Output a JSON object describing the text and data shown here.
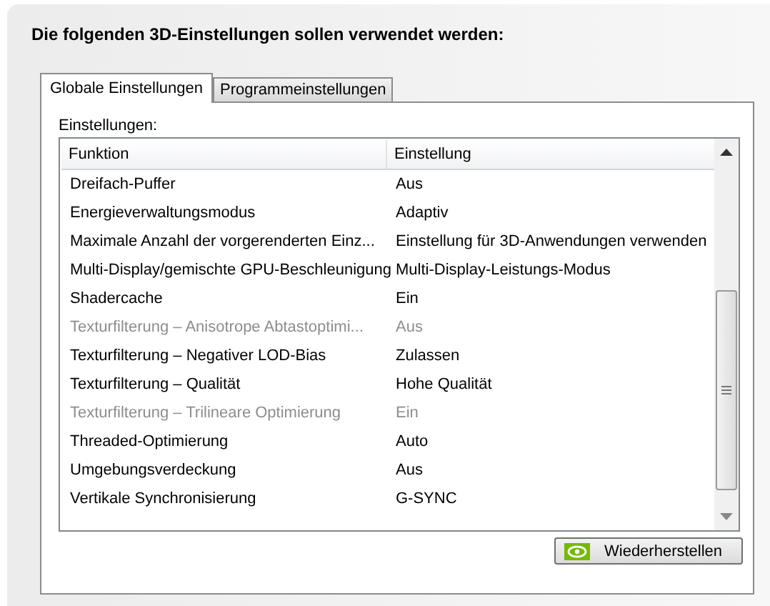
{
  "heading": "Die folgenden 3D-Einstellungen sollen verwendet werden:",
  "tabs": [
    {
      "label": "Globale Einstellungen",
      "selected": true
    },
    {
      "label": "Programmeinstellungen",
      "selected": false
    }
  ],
  "list_label": "Einstellungen:",
  "table": {
    "columns": [
      "Funktion",
      "Einstellung"
    ],
    "rows": [
      {
        "cells": [
          "Dreifach-Puffer",
          "Aus"
        ],
        "disabled": false
      },
      {
        "cells": [
          "Energieverwaltungsmodus",
          "Adaptiv"
        ],
        "disabled": false
      },
      {
        "cells": [
          "Maximale Anzahl der vorgerenderten Einz...",
          "Einstellung für 3D-Anwendungen verwenden"
        ],
        "disabled": false
      },
      {
        "cells": [
          "Multi-Display/gemischte GPU-Beschleunigung",
          "Multi-Display-Leistungs-Modus"
        ],
        "disabled": false
      },
      {
        "cells": [
          "Shadercache",
          "Ein"
        ],
        "disabled": false
      },
      {
        "cells": [
          "Texturfilterung – Anisotrope Abtastoptimi...",
          "Aus"
        ],
        "disabled": true
      },
      {
        "cells": [
          "Texturfilterung – Negativer LOD-Bias",
          "Zulassen"
        ],
        "disabled": false
      },
      {
        "cells": [
          "Texturfilterung – Qualität",
          "Hohe Qualität"
        ],
        "disabled": false
      },
      {
        "cells": [
          "Texturfilterung – Trilineare Optimierung",
          "Ein"
        ],
        "disabled": true
      },
      {
        "cells": [
          "Threaded-Optimierung",
          "Auto"
        ],
        "disabled": false
      },
      {
        "cells": [
          "Umgebungsverdeckung",
          "Aus"
        ],
        "disabled": false
      },
      {
        "cells": [
          "Vertikale Synchronisierung",
          "G-SYNC"
        ],
        "disabled": false
      }
    ]
  },
  "restore_button": "Wiederherstellen"
}
